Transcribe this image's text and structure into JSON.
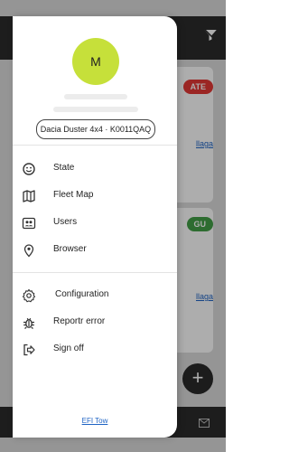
{
  "drawer": {
    "avatar_initial": "M",
    "vehicle": "Dacia Duster 4x4 · K0011QAQ",
    "menu": {
      "state": "State",
      "fleet_map": "Fleet Map",
      "users": "Users",
      "browser": "Browser",
      "configuration": "Configuration",
      "report_error": "Reportr error",
      "sign_off": "Sign off"
    },
    "footer_link": "EFI Tow"
  },
  "background": {
    "badge1": "ATE",
    "badge2": "GU",
    "link1": "llaga",
    "link2": "llaga",
    "fab": "+"
  },
  "colors": {
    "avatar": "#c6e03a",
    "link": "#1e63c4",
    "badge_red": "#e53935",
    "badge_green": "#43a047"
  }
}
